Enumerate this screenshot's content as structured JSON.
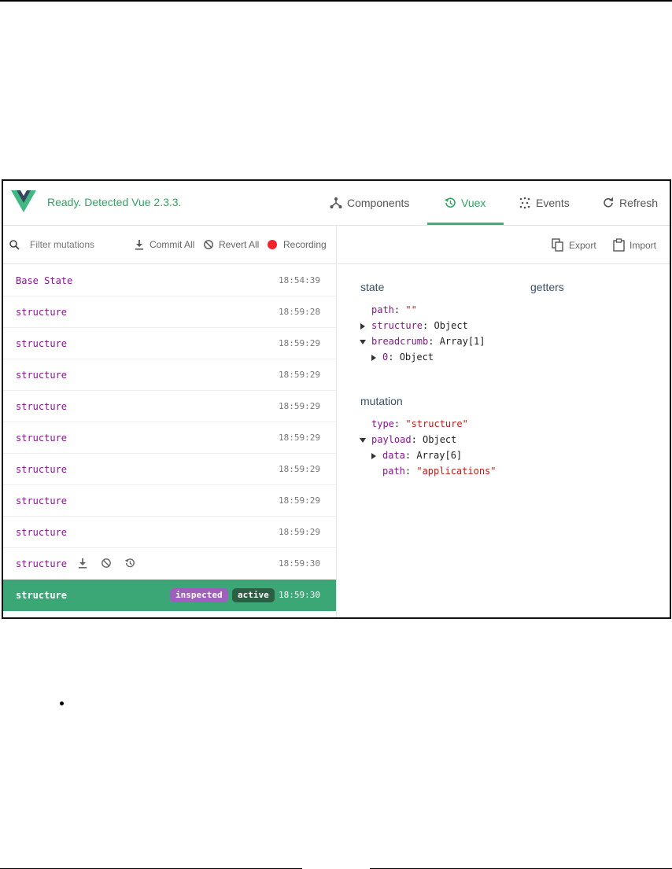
{
  "header": {
    "status": "Ready. Detected Vue 2.3.3.",
    "tabs": [
      {
        "label": "Components",
        "icon": "components-icon"
      },
      {
        "label": "Vuex",
        "icon": "history-icon"
      },
      {
        "label": "Events",
        "icon": "events-icon"
      },
      {
        "label": "Refresh",
        "icon": "refresh-icon"
      }
    ],
    "active_tab": "Vuex",
    "accent": "#3eaf7c"
  },
  "toolbar": {
    "filter_placeholder": "Filter mutations",
    "commit_all": "Commit All",
    "revert_all": "Revert All",
    "recording": "Recording",
    "export": "Export",
    "import": "Import"
  },
  "mutations": [
    {
      "name": "Base State",
      "time": "18:54:39"
    },
    {
      "name": "structure",
      "time": "18:59:28"
    },
    {
      "name": "structure",
      "time": "18:59:29"
    },
    {
      "name": "structure",
      "time": "18:59:29"
    },
    {
      "name": "structure",
      "time": "18:59:29"
    },
    {
      "name": "structure",
      "time": "18:59:29"
    },
    {
      "name": "structure",
      "time": "18:59:29"
    },
    {
      "name": "structure",
      "time": "18:59:29"
    },
    {
      "name": "structure",
      "time": "18:59:29"
    },
    {
      "name": "structure",
      "time": "18:59:30"
    },
    {
      "name": "structure",
      "time": "18:59:30",
      "tags": [
        "inspected",
        "active"
      ]
    }
  ],
  "inspector": {
    "state_title": "state",
    "getters_title": "getters",
    "mutation_title": "mutation",
    "state": {
      "path_key": "path",
      "path_val": "\"\"",
      "structure_key": "structure",
      "structure_val": "Object",
      "breadcrumb_key": "breadcrumb",
      "breadcrumb_val": "Array[1]",
      "item0_key": "0",
      "item0_val": "Object"
    },
    "mutation": {
      "type_key": "type",
      "type_val": "\"structure\"",
      "payload_key": "payload",
      "payload_val": "Object",
      "data_key": "data",
      "data_val": "Array[6]",
      "path_key": "path",
      "path_val": "\"applications\""
    }
  }
}
